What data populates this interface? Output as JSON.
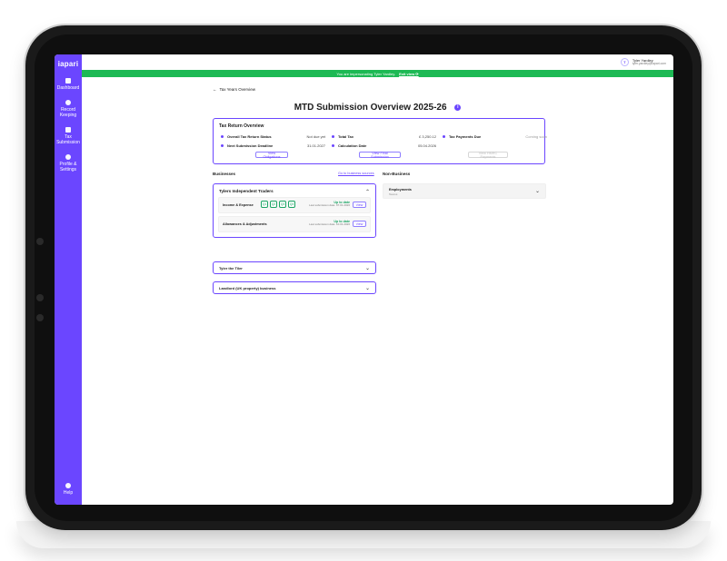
{
  "sidebar": {
    "brand": "iapari",
    "items": [
      {
        "label": "Dashboard",
        "icon": "dashboard-icon"
      },
      {
        "label": "Record Keeping",
        "icon": "records-icon"
      },
      {
        "label": "Tax Submission",
        "icon": "tax-icon"
      },
      {
        "label": "Profile & Settings",
        "icon": "settings-icon"
      }
    ],
    "help": {
      "label": "Help",
      "icon": "help-icon"
    }
  },
  "topbar": {
    "user_initial": "T",
    "user_name": "Tyler Yardley",
    "user_email": "tyler.yardley@iapari.com"
  },
  "banner": {
    "text": "You are impersonating Tyler Yardley.",
    "link": "Exit view ⟳",
    "color": "#1db954"
  },
  "back": {
    "label": "Tax Years Overview",
    "icon": "arrow-left-icon"
  },
  "page": {
    "title": "MTD Submission Overview 2025-26",
    "title_icon": "info-icon"
  },
  "overview": {
    "title": "Tax Return Overview",
    "rows": [
      [
        {
          "label": "Overall Tax Return Status",
          "value": "Not due yet",
          "muted": false
        },
        {
          "label": "Total Tax",
          "value": "£ 3,250.12",
          "muted": false
        },
        {
          "label": "Tax Payments Due",
          "value": "Coming soon",
          "muted": true
        }
      ],
      [
        {
          "label": "Next Submission Deadline",
          "value": "31.01.2027",
          "muted": false
        },
        {
          "label": "Calculation Date",
          "value": "05.04.2026",
          "muted": false
        }
      ]
    ],
    "buttons": {
      "obligations": "View Obligations",
      "final": "View Final Submission",
      "payments": "View HMRC Payments"
    }
  },
  "sections": {
    "businesses": "Businesses",
    "businesses_link": "Go to business sources",
    "non_business": "Non-Business"
  },
  "businesses": [
    {
      "name": "Tylers Independent Traders",
      "expanded": true,
      "rows": [
        {
          "label": "Income & Expense",
          "quarters": [
            "Q1",
            "Q2",
            "Q3",
            "Q4"
          ],
          "status": "Up to date",
          "sub": "Last submission date: 07.01.2026",
          "button": "View"
        },
        {
          "label": "Allowances & Adjustments",
          "quarters": [],
          "status": "Up to date",
          "sub": "Last submission date: 10.01.2026",
          "button": "View"
        }
      ]
    },
    {
      "name": "Tyler the Tiler",
      "expanded": false
    },
    {
      "name": "Landlord (UK property) business",
      "expanded": false
    }
  ],
  "non_business": [
    {
      "label": "Employments",
      "sub": "Tescos"
    }
  ],
  "colors": {
    "brand": "#6b46ff",
    "success": "#19a463"
  }
}
